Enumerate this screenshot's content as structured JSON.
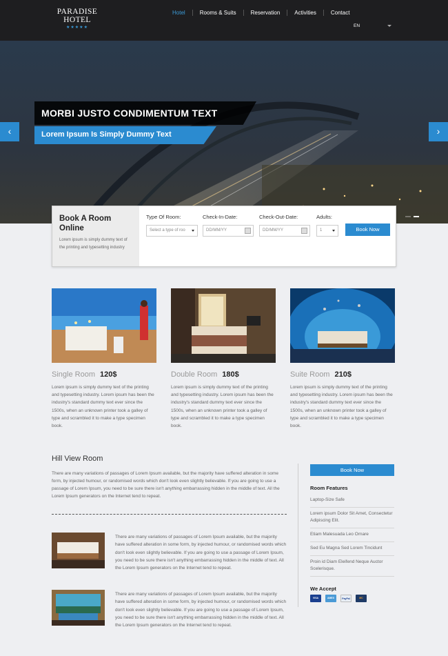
{
  "header": {
    "logo": "PARADISE HOTEL",
    "logo_stars": "★★★★★",
    "nav": [
      "Hotel",
      "Rooms & Suits",
      "Reservation",
      "Activities",
      "Contact"
    ],
    "language": "EN"
  },
  "hero": {
    "title": "MORBI JUSTO CONDIMENTUM TEXT",
    "subtitle": "Lorem Ipsum Is Simply Dummy Text",
    "prev_icon": "chevron-left-icon",
    "next_icon": "chevron-right-icon",
    "slide_count": 2,
    "active_slide": 2
  },
  "booking": {
    "title": "Book A Room Online",
    "description": "Lorem ipsum is simply dummy text of the printing and typesetting industry",
    "room_type_label": "Type Of Room:",
    "room_type_placeholder": "Select a type of roo",
    "checkin_label": "Check-In-Date:",
    "checkin_placeholder": "DD/MM/YY",
    "checkout_label": "Check-Out-Date:",
    "checkout_placeholder": "DD/MM/YY",
    "adults_label": "Adults:",
    "adults_value": "1",
    "button": "Book Now"
  },
  "rooms": [
    {
      "name": "Single Room",
      "price": "120$",
      "description": "Lorem ipsum is simply dummy text of the printing and typesetting industry. Lorem ipsum has been the industry's standard dummy text ever since the 1500s, when an unknown printer took a galley of type and scrambled it to make a type specimen book."
    },
    {
      "name": "Double Room",
      "price": "180$",
      "description": "Lorem ipsum is simply dummy text of the printing and typesetting industry. Lorem ipsum has been the industry's standard dummy text ever since the 1500s, when an unknown printer took a galley of type and scrambled it to make a type specimen book."
    },
    {
      "name": "Suite Room",
      "price": "210$",
      "description": "Lorem ipsum is simply dummy text of the printing and typesetting industry. Lorem ipsum has been the industry's standard dummy text ever since the 1500s, when an unknown printer took a galley of type and scrambled it to make a type specimen book."
    }
  ],
  "hill_view": {
    "title": "Hill View Room",
    "text": "There are many variations of passages of Lorem Ipsum available, but the majority have suffered alteration in some form, by injected humour, or randomised words which don't look even slightly believable. If you are going to use a passage of Lorem Ipsum, you need to be sure there isn't anything embarrassing hidden in the middle of text. All the Lorem Ipsum generators on the Internet tend to repeat.",
    "features": [
      {
        "text": "There are many variations of passages of Lorem Ipsum available, but the majority have suffered alteration in some form, by injected humour, or randomised words which don't look even slightly believable. If you are going to use a passage of Lorem Ipsum, you need to be sure there isn't anything embarrassing hidden in the middle of text. All the Lorem Ipsum generators on the Internet tend to repeat."
      },
      {
        "text": "There are many variations of passages of Lorem Ipsum available, but the majority have suffered alteration in some form, by injected humour, or randomised words which don't look even slightly believable. If you are going to use a passage of Lorem Ipsum, you need to be sure there isn't anything embarrassing hidden in the middle of text. All the Lorem Ipsum generators on the Internet tend to repeat."
      }
    ]
  },
  "sidebar": {
    "button": "Book Now",
    "features_heading": "Room Features",
    "features": [
      "Laptop-Size Safe",
      "Lorem ipsum Dolor Sit Amet, Consectetur Adipiscing Elit.",
      "Etiam Malesuada Leo Ornare",
      "Sed Eu Magna Sed Lorem Tincidunt",
      "Proin id Diam Eleifend Neque Auctor Scelerisque."
    ],
    "accept_heading": "We Accept",
    "cards": [
      {
        "label": "VISA",
        "icon": "visa-card-icon",
        "color": "#1a3f8f"
      },
      {
        "label": "AMEX",
        "icon": "amex-card-icon",
        "color": "#4a9ad6"
      },
      {
        "label": "PayPal",
        "icon": "paypal-card-icon",
        "color": "#e8eef5"
      },
      {
        "label": "MC",
        "icon": "mastercard-icon",
        "color": "#1e3a66"
      }
    ]
  },
  "colors": {
    "accent": "#2b8bd0",
    "header_bg": "#1e1e20",
    "page_bg": "#eeeff2"
  }
}
